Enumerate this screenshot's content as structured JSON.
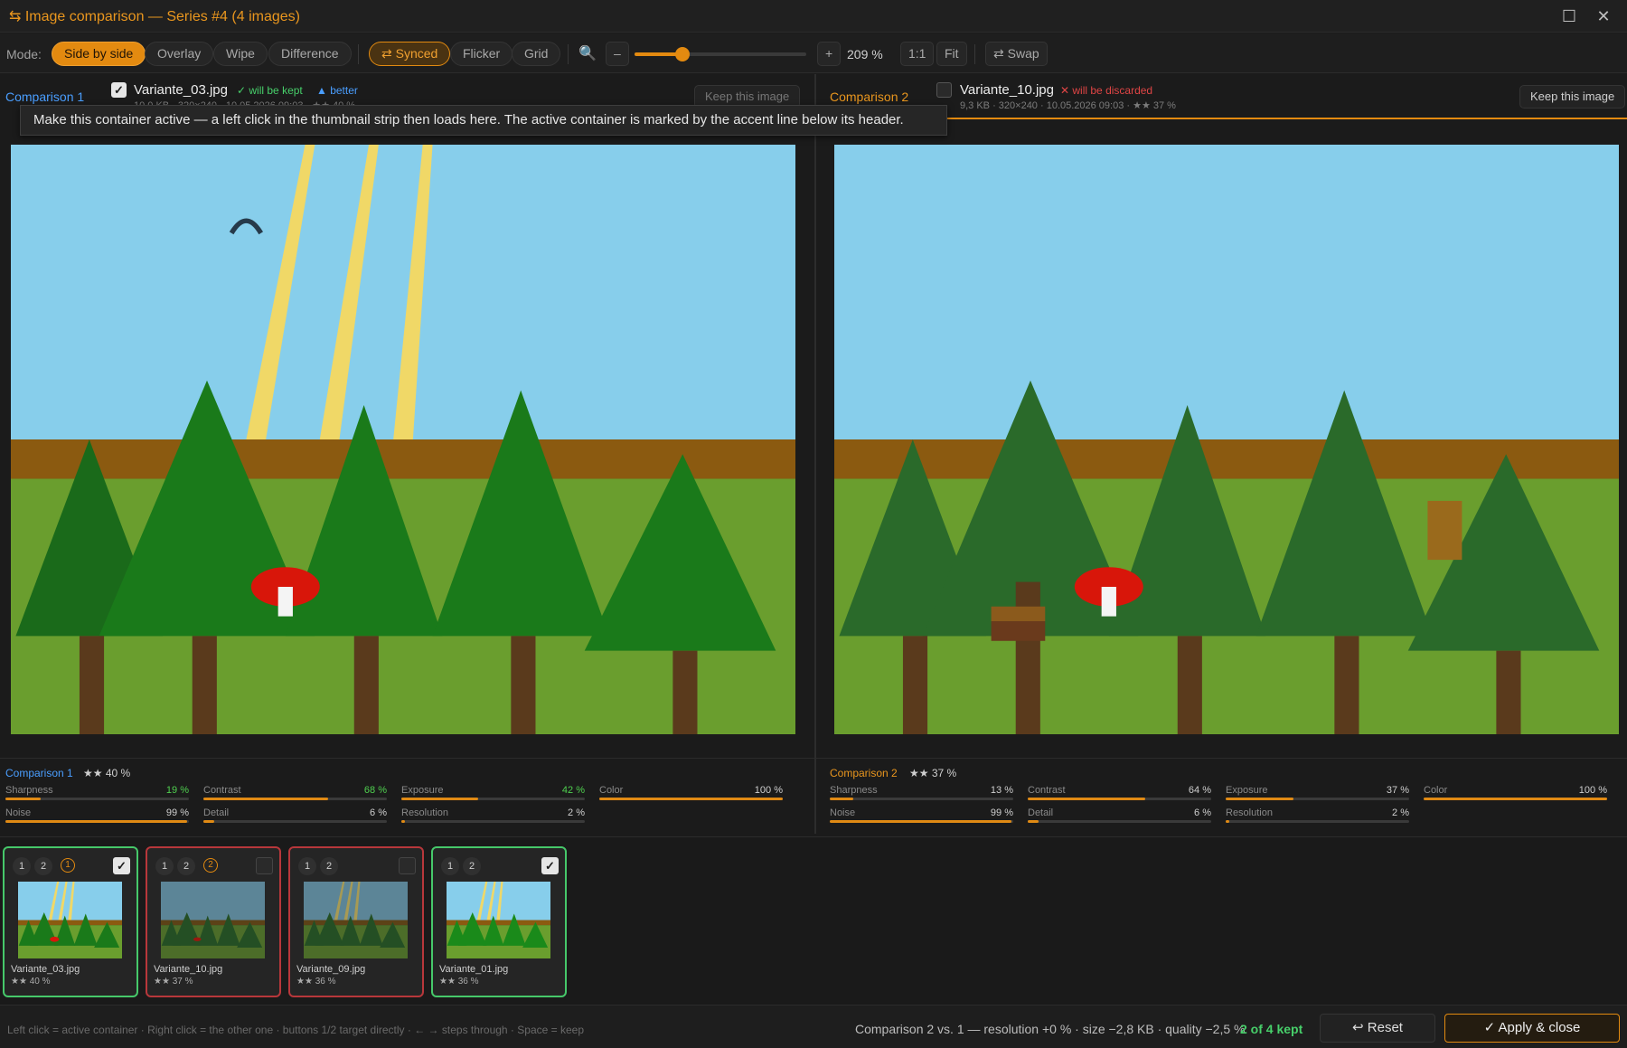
{
  "window": {
    "title": "⇆ Image comparison — Series #4 (4 images)",
    "maximize_icon": "☐",
    "close_icon": "✕"
  },
  "toolbar": {
    "mode_label": "Mode:",
    "modes": [
      "Side by side",
      "Overlay",
      "Wipe",
      "Difference"
    ],
    "active_mode": "Side by side",
    "synced_label": "⇄ Synced",
    "flicker_label": "Flicker",
    "grid_label": "Grid",
    "zoom_icon": "🔍",
    "zoom_minus": "–",
    "zoom_plus": "+",
    "zoom_value": "209 %",
    "zoom_level_fraction": 0.28,
    "one_to_one": "1:1",
    "fit": "Fit",
    "swap": "⇄ Swap"
  },
  "panel1": {
    "title": "Comparison 1",
    "checked": true,
    "filename": "Variante_03.jpg",
    "status": "✓ will be kept",
    "badge": "▲ better",
    "meta": "10,0 KB · 320×240 · 10.05.2026 09:03 · ★★ 40 %",
    "keep_button": "Keep this image"
  },
  "panel2": {
    "title": "Comparison 2",
    "checked": false,
    "filename": "Variante_10.jpg",
    "status": "✕ will be discarded",
    "meta": "9,3 KB · 320×240 · 10.05.2026 09:03 · ★★ 37 %",
    "keep_button": "Keep this image"
  },
  "tooltip": "Make this container active — a left click in the thumbnail strip then loads here. The active container is marked by the accent line below its header.",
  "metrics1": {
    "title": "Comparison 1",
    "rating": "★★ 40 %",
    "items": [
      {
        "label": "Sharpness",
        "value": "19 %",
        "fraction": 0.19,
        "better": true
      },
      {
        "label": "Contrast",
        "value": "68 %",
        "fraction": 0.68,
        "better": true
      },
      {
        "label": "Exposure",
        "value": "42 %",
        "fraction": 0.42,
        "better": true
      },
      {
        "label": "Color",
        "value": "100 %",
        "fraction": 1.0,
        "better": false
      },
      {
        "label": "Noise",
        "value": "99 %",
        "fraction": 0.99,
        "better": false
      },
      {
        "label": "Detail",
        "value": "6 %",
        "fraction": 0.06,
        "better": false
      },
      {
        "label": "Resolution",
        "value": "2 %",
        "fraction": 0.02,
        "better": false
      }
    ]
  },
  "metrics2": {
    "title": "Comparison 2",
    "rating": "★★ 37 %",
    "items": [
      {
        "label": "Sharpness",
        "value": "13 %",
        "fraction": 0.13,
        "better": false
      },
      {
        "label": "Contrast",
        "value": "64 %",
        "fraction": 0.64,
        "better": false
      },
      {
        "label": "Exposure",
        "value": "37 %",
        "fraction": 0.37,
        "better": false
      },
      {
        "label": "Color",
        "value": "100 %",
        "fraction": 1.0,
        "better": false
      },
      {
        "label": "Noise",
        "value": "99 %",
        "fraction": 0.99,
        "better": false
      },
      {
        "label": "Detail",
        "value": "6 %",
        "fraction": 0.06,
        "better": false
      },
      {
        "label": "Resolution",
        "value": "2 %",
        "fraction": 0.02,
        "better": false
      }
    ]
  },
  "thumbnails": [
    {
      "name": "Variante_03.jpg",
      "stars": "★★ 40 %",
      "kept": true,
      "badge": "1",
      "num1": "1",
      "num2": "2"
    },
    {
      "name": "Variante_10.jpg",
      "stars": "★★ 37 %",
      "kept": false,
      "badge": "2",
      "num1": "1",
      "num2": "2"
    },
    {
      "name": "Variante_09.jpg",
      "stars": "★★ 36 %",
      "kept": false,
      "badge": "",
      "num1": "1",
      "num2": "2"
    },
    {
      "name": "Variante_01.jpg",
      "stars": "★★ 36 %",
      "kept": true,
      "badge": "",
      "num1": "1",
      "num2": "2"
    }
  ],
  "statusbar": {
    "hint": "Left click = active container · Right click = the other one · buttons 1/2 target directly · ← → steps through · Space = keep",
    "comparison": "Comparison 2 vs. 1 — resolution +0 % · size −2,8 KB · quality −2,5 %",
    "kept_count": "2 of 4 kept",
    "reset": "↩ Reset",
    "apply": "✓ Apply & close"
  },
  "colors": {
    "accent": "#e38a10",
    "kept": "#46c86a",
    "discarded": "#b8373b",
    "link": "#4a9eff"
  }
}
